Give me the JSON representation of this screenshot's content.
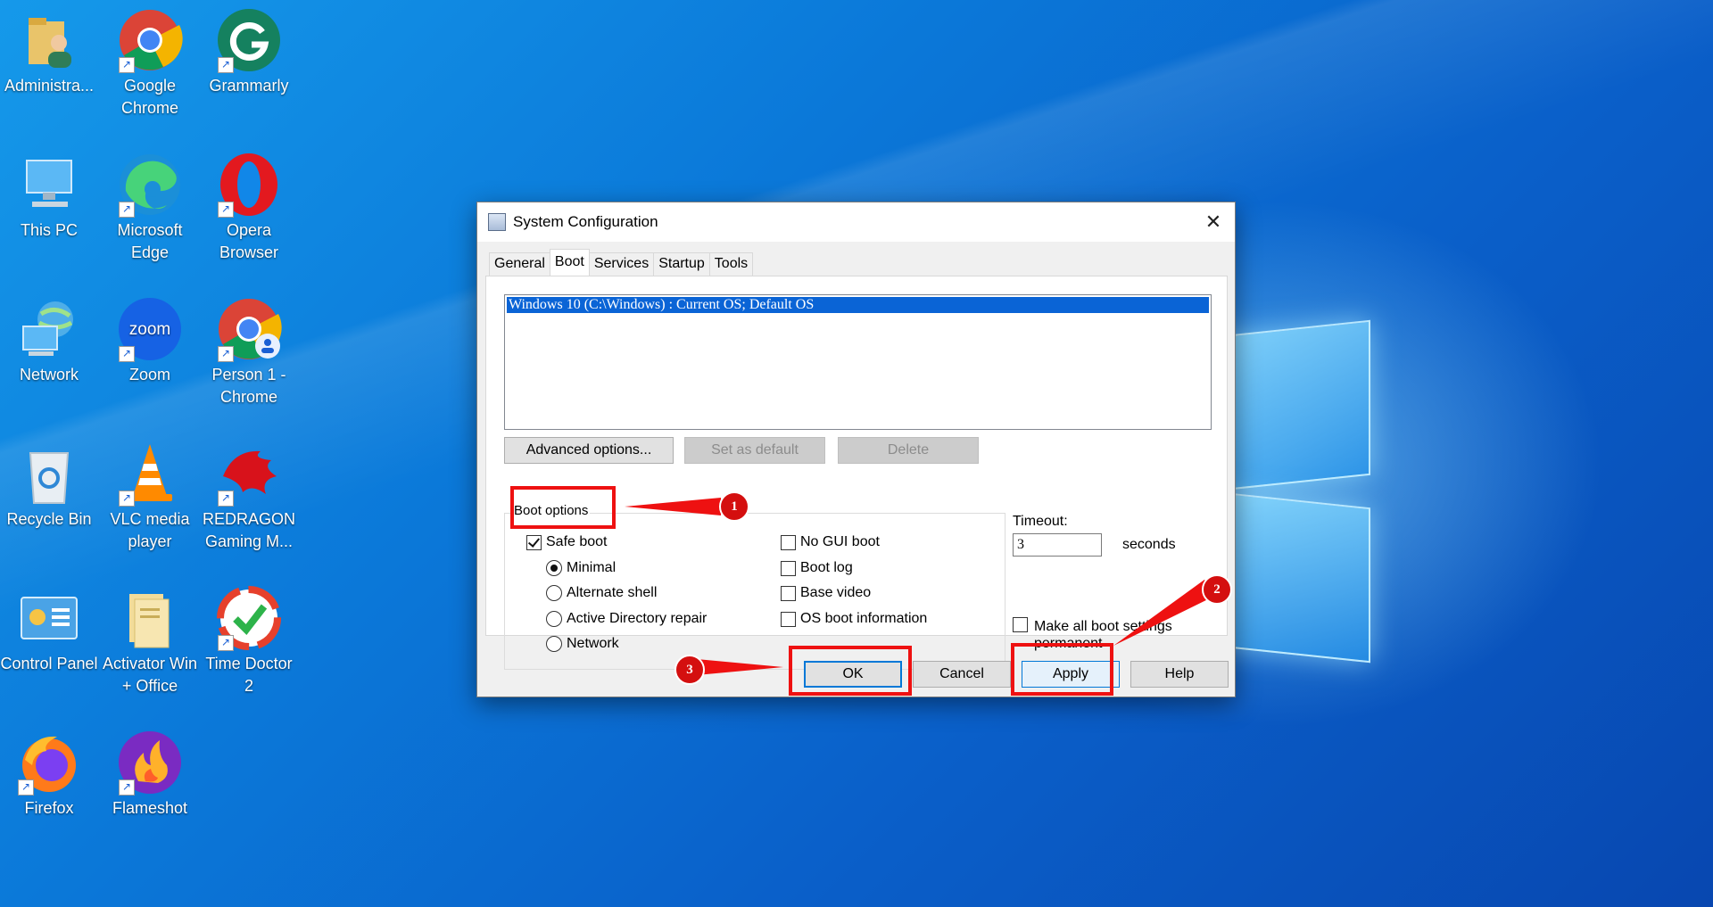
{
  "desktop": {
    "icons": [
      {
        "name": "administrator-folder-icon",
        "label": "Administra..."
      },
      {
        "name": "chrome-icon",
        "label": "Google Chrome"
      },
      {
        "name": "grammarly-icon",
        "label": "Grammarly"
      },
      {
        "name": "this-pc-icon",
        "label": "This PC"
      },
      {
        "name": "edge-icon",
        "label": "Microsoft Edge"
      },
      {
        "name": "opera-icon",
        "label": "Opera Browser"
      },
      {
        "name": "network-icon",
        "label": "Network"
      },
      {
        "name": "zoom-icon",
        "label": "Zoom"
      },
      {
        "name": "chrome-person-icon",
        "label": "Person 1 - Chrome"
      },
      {
        "name": "recycle-bin-icon",
        "label": "Recycle Bin"
      },
      {
        "name": "vlc-icon",
        "label": "VLC media player"
      },
      {
        "name": "redragon-icon",
        "label": "REDRAGON Gaming M..."
      },
      {
        "name": "control-panel-icon",
        "label": "Control Panel"
      },
      {
        "name": "activator-folder-icon",
        "label": "Activator Win + Office"
      },
      {
        "name": "time-doctor-icon",
        "label": "Time Doctor 2"
      },
      {
        "name": "firefox-icon",
        "label": "Firefox"
      },
      {
        "name": "flameshot-icon",
        "label": "Flameshot"
      }
    ],
    "zoom_logo_text": "zoom"
  },
  "dialog": {
    "title": "System Configuration",
    "close_glyph": "✕",
    "tabs": [
      "General",
      "Boot",
      "Services",
      "Startup",
      "Tools"
    ],
    "active_tab": "Boot",
    "os_entries": [
      "Windows 10 (C:\\Windows) : Current OS; Default OS"
    ],
    "buttons": {
      "advanced": "Advanced options...",
      "set_default": "Set as default",
      "delete": "Delete",
      "ok": "OK",
      "cancel": "Cancel",
      "apply": "Apply",
      "help": "Help"
    },
    "boot_options": {
      "label": "Boot options",
      "safe_boot": "Safe boot",
      "minimal": "Minimal",
      "alternate_shell": "Alternate shell",
      "ad_repair": "Active Directory repair",
      "network": "Network",
      "no_gui_boot": "No GUI boot",
      "boot_log": "Boot log",
      "base_video": "Base video",
      "os_boot_info": "OS boot information"
    },
    "timeout": {
      "label": "Timeout:",
      "value": "3",
      "unit": "seconds"
    },
    "make_permanent": "Make all boot settings permanent"
  },
  "annotations": {
    "badges": [
      "1",
      "2",
      "3"
    ],
    "color": "#ee1111"
  }
}
